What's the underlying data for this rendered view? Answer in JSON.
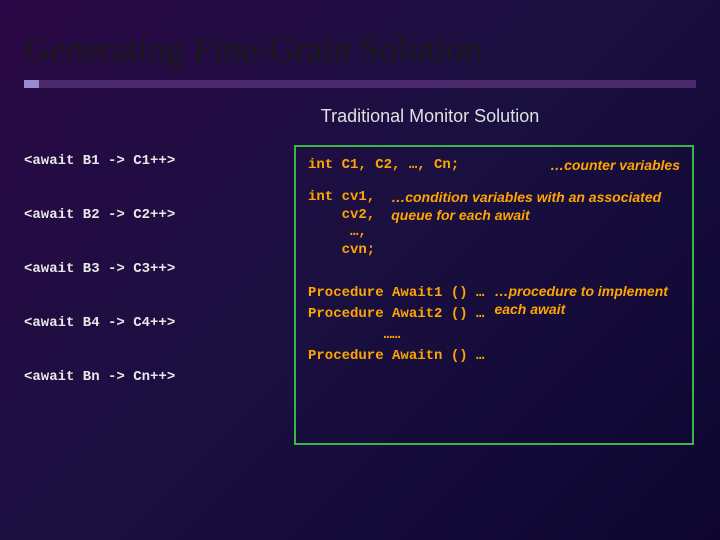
{
  "title": "Generating Fine-Grain Solution",
  "subtitle": "Traditional Monitor Solution",
  "awaits": [
    "<await B1 -> C1++>",
    "<await B2 -> C2++>",
    "<await B3 -> C3++>",
    "<await B4 -> C4++>",
    "<await Bn -> Cn++>"
  ],
  "monitor": {
    "counter_decl": "int C1, C2, …, Cn;",
    "counter_comment": "…counter variables",
    "condvar_decl": "int cv1,\n    cv2,\n     …,\n    cvn;",
    "condvar_comment": "…condition variables with an associated queue for each await",
    "procs": "Procedure Await1 () …\nProcedure Await2 () …\n         ……\nProcedure Awaitn () …",
    "procs_comment": "…procedure to implement each await"
  }
}
